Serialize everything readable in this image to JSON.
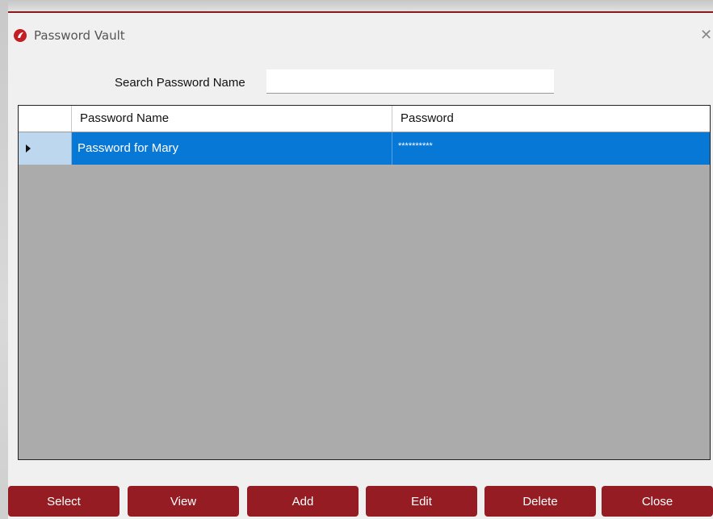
{
  "window": {
    "title": "Password Vault",
    "close_glyph": "✕",
    "icon": "app-logo-icon",
    "accent_color": "#951c22"
  },
  "search": {
    "label": "Search Password Name",
    "value": "",
    "placeholder": ""
  },
  "grid": {
    "columns": [
      "Password Name",
      "Password"
    ],
    "rows": [
      {
        "name": "Password for Mary",
        "password": "**********",
        "selected": true
      }
    ],
    "selection_color": "#0878d7",
    "empty_area_color": "#ababab"
  },
  "buttons": {
    "select": "Select",
    "view": "View",
    "add": "Add",
    "edit": "Edit",
    "delete": "Delete",
    "close": "Close"
  }
}
